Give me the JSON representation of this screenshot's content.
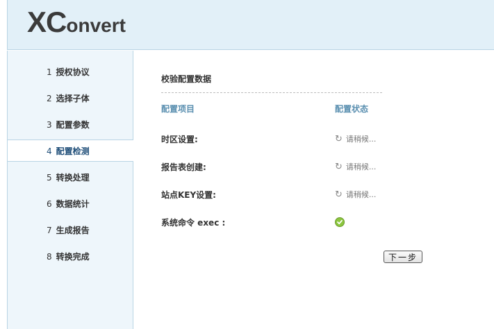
{
  "logo": {
    "initial": "XC",
    "rest": "onvert"
  },
  "steps": [
    {
      "num": "1",
      "label": "授权协议"
    },
    {
      "num": "2",
      "label": "选择子体"
    },
    {
      "num": "3",
      "label": "配置参数"
    },
    {
      "num": "4",
      "label": "配置检测",
      "active": true
    },
    {
      "num": "5",
      "label": "转换处理"
    },
    {
      "num": "6",
      "label": "数据统计"
    },
    {
      "num": "7",
      "label": "生成报告"
    },
    {
      "num": "8",
      "label": "转换完成"
    }
  ],
  "main": {
    "title": "校验配置数据",
    "col_item": "配置项目",
    "col_status": "配置状态",
    "rows": [
      {
        "label": "时区设置:",
        "status": "请稍候...",
        "state": "loading"
      },
      {
        "label": "报告表创建:",
        "status": "请稍候...",
        "state": "loading"
      },
      {
        "label": "站点KEY设置:",
        "status": "请稍候...",
        "state": "loading"
      },
      {
        "label": "系统命令 exec :",
        "status": "",
        "state": "ok"
      }
    ],
    "next_label": "下一步"
  },
  "colors": {
    "header_bg": "#e2f0f8",
    "sidebar_bg": "#eef6fb",
    "accent": "#5a8fb0",
    "ok": "#8cc63f"
  }
}
